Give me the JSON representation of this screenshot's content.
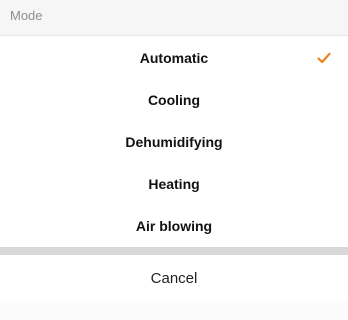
{
  "sheet": {
    "title": "Mode",
    "options": [
      {
        "label": "Automatic",
        "selected": true
      },
      {
        "label": "Cooling",
        "selected": false
      },
      {
        "label": "Dehumidifying",
        "selected": false
      },
      {
        "label": "Heating",
        "selected": false
      },
      {
        "label": "Air blowing",
        "selected": false
      }
    ],
    "cancel_label": "Cancel"
  },
  "colors": {
    "accent_check": "#f07f1d"
  },
  "icons": {
    "selected_indicator": "check-icon"
  }
}
